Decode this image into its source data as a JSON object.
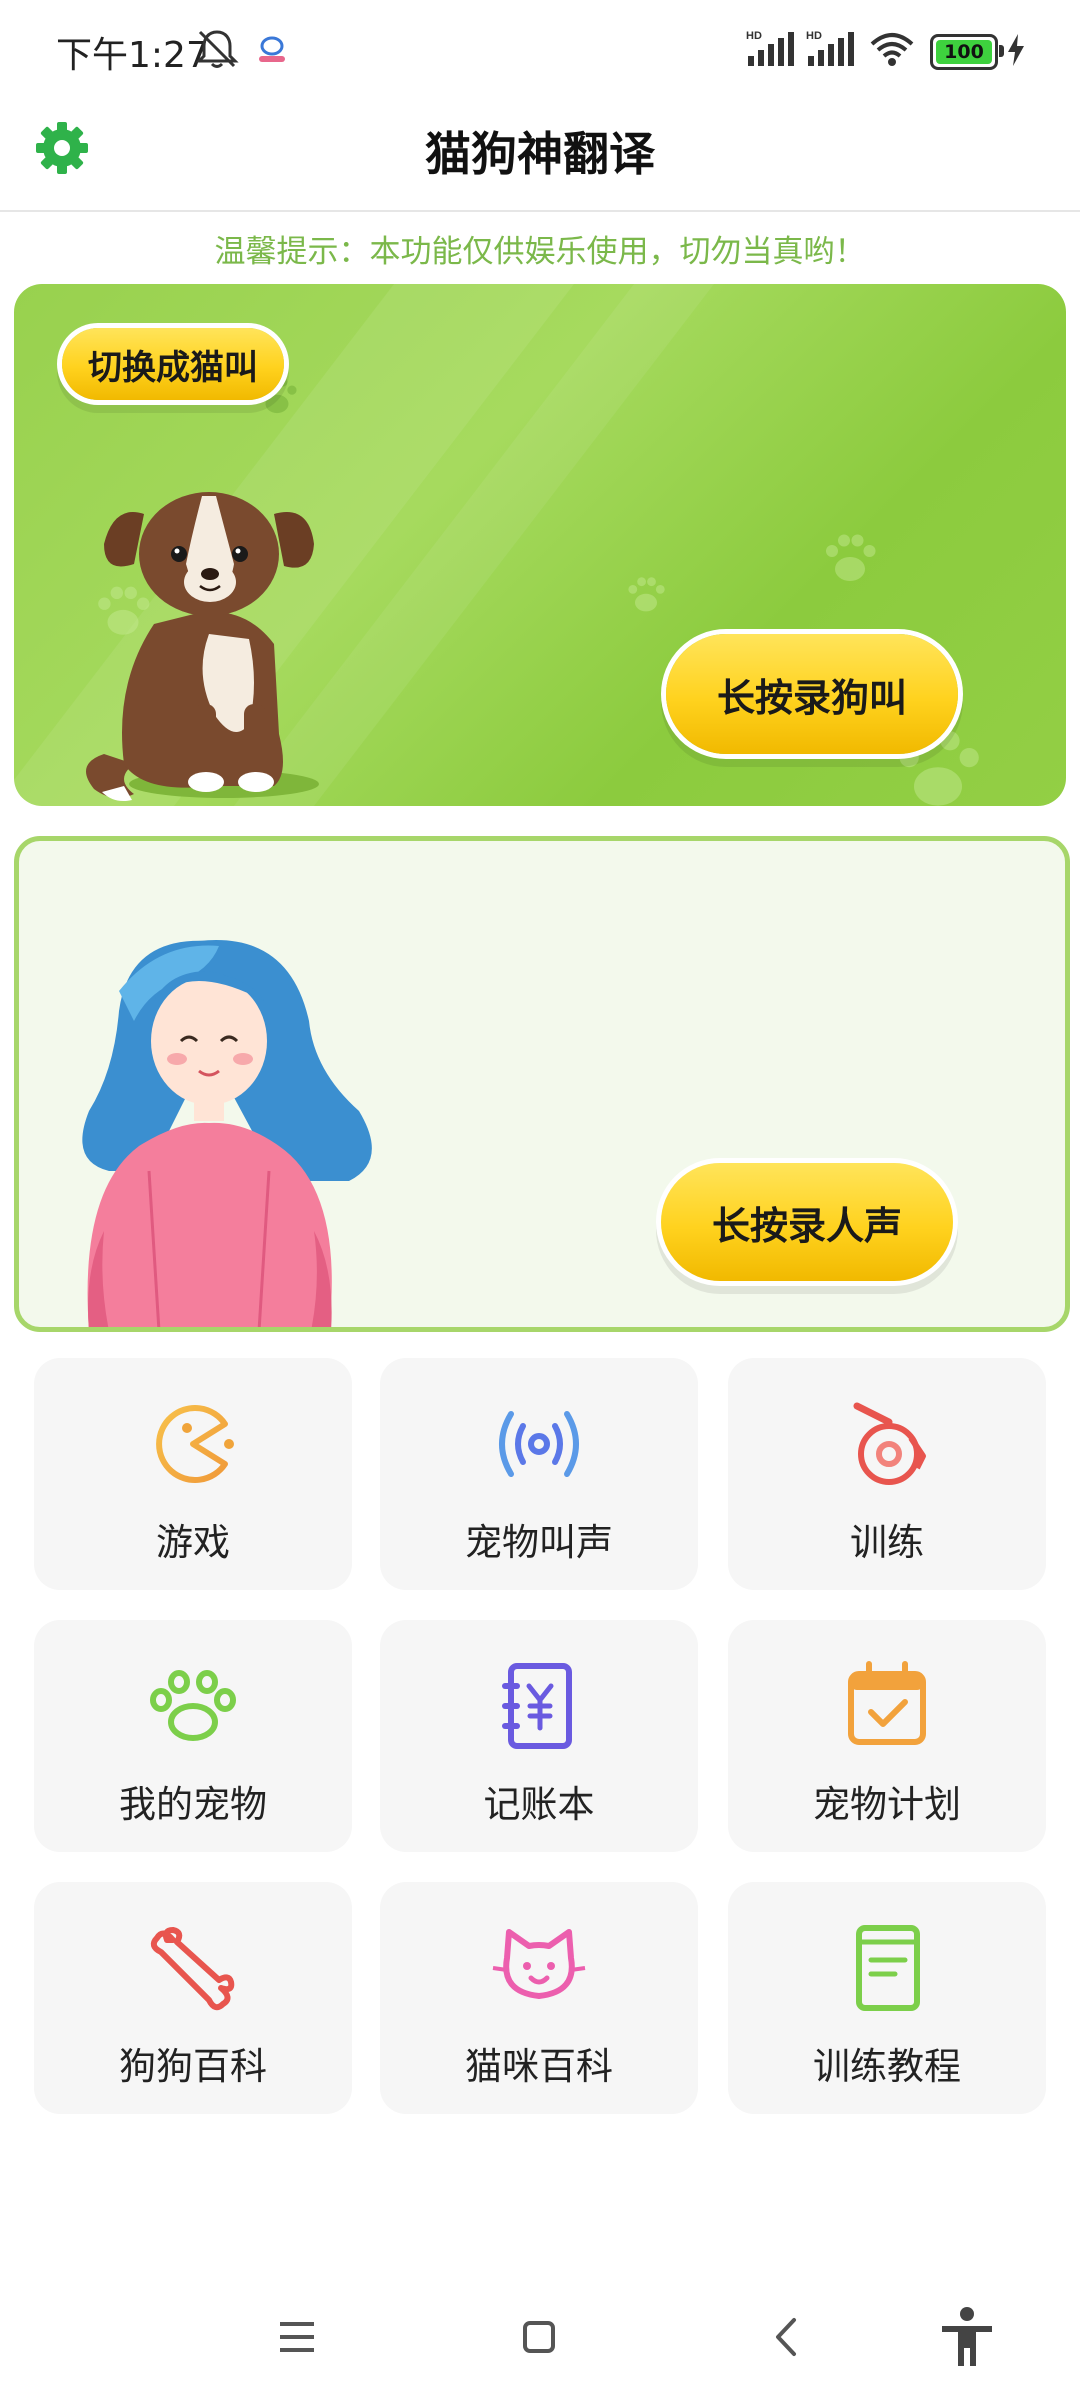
{
  "status_bar": {
    "time": "下午1:27",
    "battery": "100"
  },
  "header": {
    "title": "猫狗神翻译"
  },
  "notice": "温馨提示：本功能仅供娱乐使用，切勿当真哟！",
  "dog_card": {
    "switch_label": "切换成猫叫",
    "record_label": "长按录狗叫"
  },
  "human_card": {
    "record_label": "长按录人声"
  },
  "grid": [
    {
      "label": "游戏",
      "icon": "pacman-icon"
    },
    {
      "label": "宠物叫声",
      "icon": "sound-wave-icon"
    },
    {
      "label": "训练",
      "icon": "whistle-icon"
    },
    {
      "label": "我的宠物",
      "icon": "paw-icon"
    },
    {
      "label": "记账本",
      "icon": "ledger-icon"
    },
    {
      "label": "宠物计划",
      "icon": "calendar-icon"
    },
    {
      "label": "狗狗百科",
      "icon": "bone-icon"
    },
    {
      "label": "猫咪百科",
      "icon": "cat-face-icon"
    },
    {
      "label": "训练教程",
      "icon": "book-icon"
    }
  ],
  "colors": {
    "accent_green": "#8ccb3e",
    "notice_green": "#7bb84a",
    "button_yellow": "#ffd21e"
  }
}
